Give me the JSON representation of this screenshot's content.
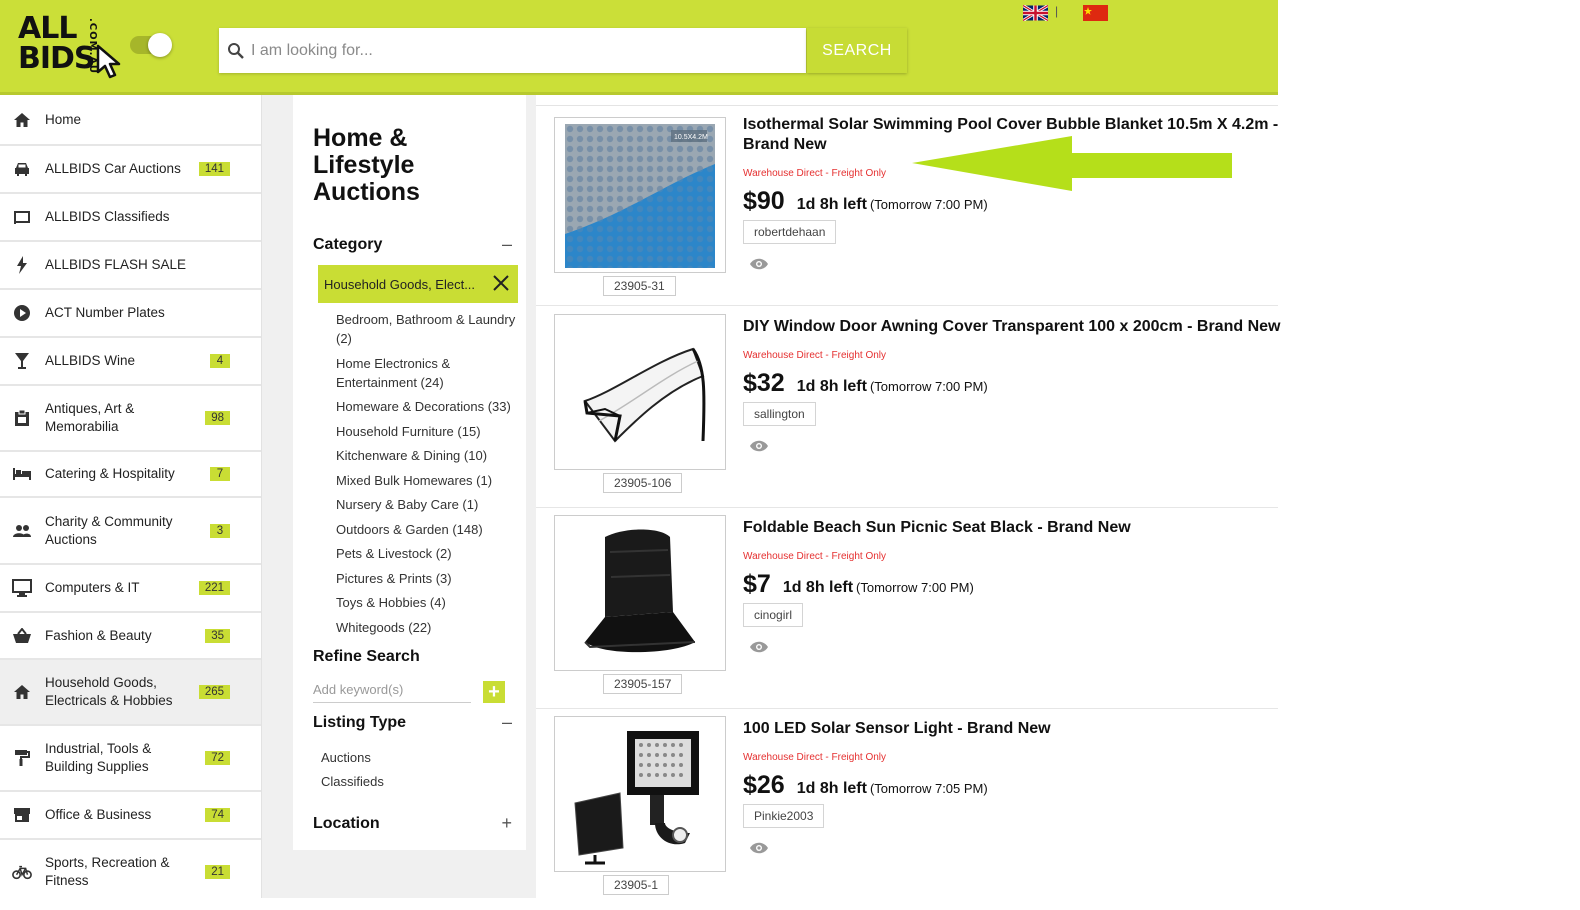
{
  "header": {
    "logo_main_1": "ALL",
    "logo_main_2": "BIDS",
    "logo_side": ".COM.AU",
    "search_placeholder": "I am looking for...",
    "search_button": "SEARCH",
    "flag_separator": "|",
    "accent": "#cbdf38"
  },
  "sidebar": {
    "items": [
      {
        "label": "Home",
        "icon": "home-icon",
        "badge": ""
      },
      {
        "label": "ALLBIDS Car Auctions",
        "icon": "car-icon",
        "badge": "141"
      },
      {
        "label": "ALLBIDS Classifieds",
        "icon": "classifieds-icon",
        "badge": ""
      },
      {
        "label": "ALLBIDS FLASH SALE",
        "icon": "flash-icon",
        "badge": ""
      },
      {
        "label": "ACT Number Plates",
        "icon": "play-circle-icon",
        "badge": ""
      },
      {
        "label": "ALLBIDS Wine",
        "icon": "wine-glass-icon",
        "badge": "4"
      },
      {
        "label": "Antiques, Art & Memorabilia",
        "icon": "clipboard-icon",
        "badge": "98"
      },
      {
        "label": "Catering & Hospitality",
        "icon": "bed-icon",
        "badge": "7"
      },
      {
        "label": "Charity & Community Auctions",
        "icon": "people-icon",
        "badge": "3"
      },
      {
        "label": "Computers & IT",
        "icon": "monitor-icon",
        "badge": "221"
      },
      {
        "label": "Fashion & Beauty",
        "icon": "basket-icon",
        "badge": "35"
      },
      {
        "label": "Household Goods, Electricals & Hobbies",
        "icon": "home-icon",
        "badge": "265"
      },
      {
        "label": "Industrial, Tools & Building Supplies",
        "icon": "paint-roller-icon",
        "badge": "72"
      },
      {
        "label": "Office & Business",
        "icon": "store-icon",
        "badge": "74"
      },
      {
        "label": "Sports, Recreation & Fitness",
        "icon": "bicycle-icon",
        "badge": "21"
      }
    ]
  },
  "filter": {
    "page_title": "Home & Lifestyle Auctions",
    "category_heading": "Category",
    "category_toggle": "–",
    "selected_category": "Household Goods, Elect...",
    "categories": [
      "Bedroom, Bathroom & Laundry (2)",
      "Home Electronics & Entertainment (24)",
      "Homeware & Decorations (33)",
      "Household Furniture (15)",
      "Kitchenware & Dining (10)",
      "Mixed Bulk Homewares (1)",
      "Nursery & Baby Care (1)",
      "Outdoors & Garden (148)",
      "Pets & Livestock (2)",
      "Pictures & Prints (3)",
      "Toys & Hobbies (4)",
      "Whitegoods (22)"
    ],
    "refine_heading": "Refine Search",
    "keyword_placeholder": "Add keyword(s)",
    "keyword_add": "+",
    "listing_type_heading": "Listing Type",
    "listing_type_toggle": "–",
    "listing_types": [
      "Auctions",
      "Classifieds"
    ],
    "location_heading": "Location",
    "location_toggle": "+"
  },
  "listings": [
    {
      "title": "Isothermal Solar Swimming Pool Cover Bubble Blanket 10.5m X 4.2m - Brand New",
      "thumb_label": "10.5X4.2M",
      "shipping": "Warehouse Direct - Freight Only",
      "price": "$90",
      "time_left": "1d 8h left",
      "end": "(Tomorrow 7:00 PM)",
      "seller": "robertdehaan",
      "lot": "23905-31"
    },
    {
      "title": "DIY Window Door Awning Cover Transparent 100 x 200cm - Brand New",
      "shipping": "Warehouse Direct - Freight Only",
      "price": "$32",
      "time_left": "1d 8h left",
      "end": "(Tomorrow 7:00 PM)",
      "seller": "sallington",
      "lot": "23905-106"
    },
    {
      "title": "Foldable Beach Sun Picnic Seat Black - Brand New",
      "shipping": "Warehouse Direct - Freight Only",
      "price": "$7",
      "time_left": "1d 8h left",
      "end": "(Tomorrow 7:00 PM)",
      "seller": "cinogirl",
      "lot": "23905-157"
    },
    {
      "title": "100 LED Solar Sensor Light - Brand New",
      "shipping": "Warehouse Direct - Freight Only",
      "price": "$26",
      "time_left": "1d 8h left",
      "end": "(Tomorrow 7:05 PM)",
      "seller": "Pinkie2003",
      "lot": "23905-1"
    }
  ]
}
